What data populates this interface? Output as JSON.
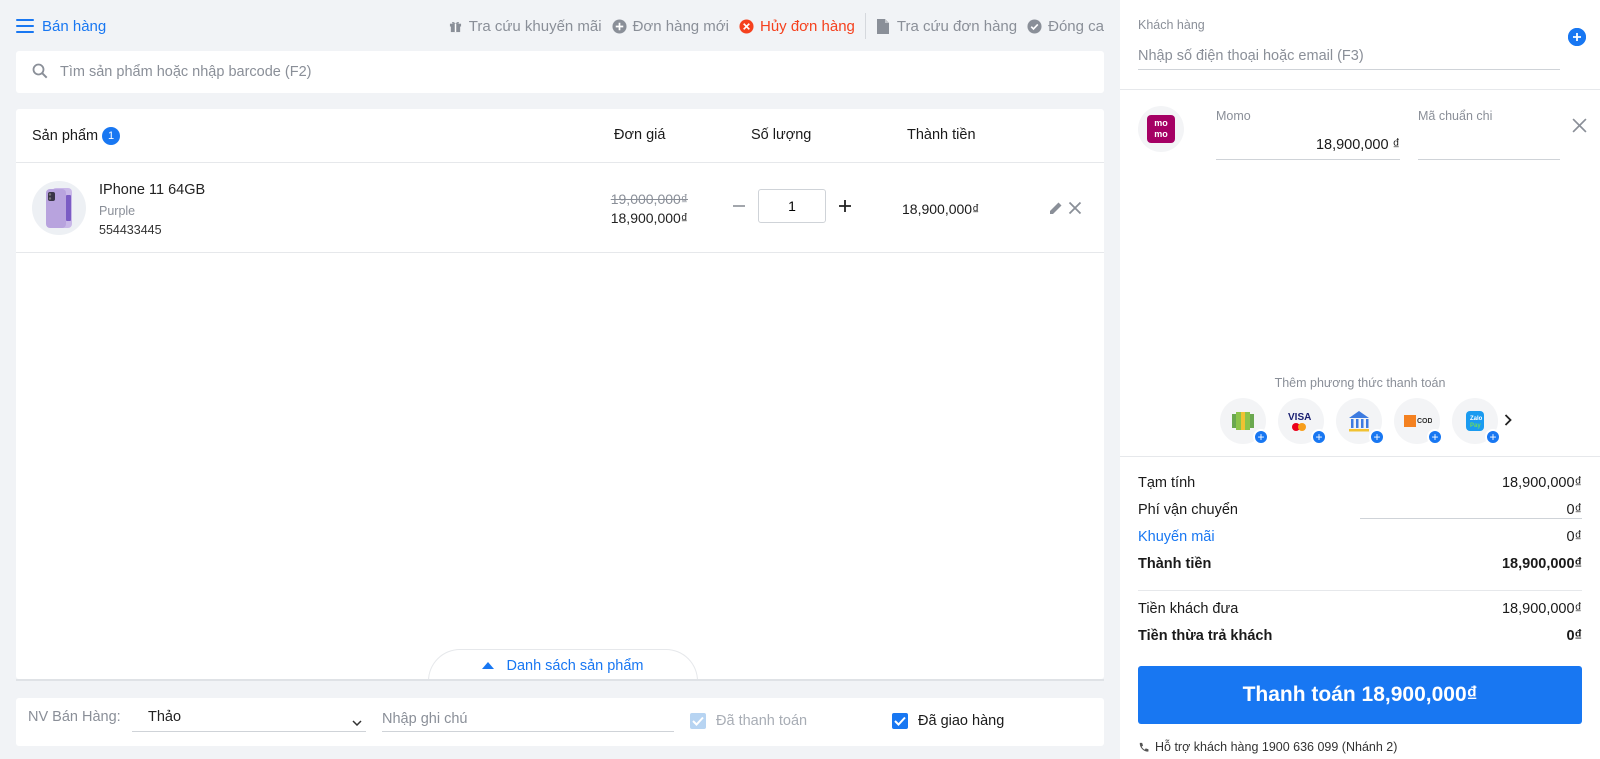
{
  "app": {
    "title": "Bán hàng"
  },
  "toolbar": {
    "promo_lookup": "Tra cứu khuyến mãi",
    "new_order": "Đơn hàng mới",
    "cancel_order": "Hủy đơn hàng",
    "order_lookup": "Tra cứu đơn hàng",
    "close_shift": "Đóng ca",
    "danger_color": "#f5411e"
  },
  "search": {
    "placeholder": "Tìm sản phẩm hoặc nhập barcode (F2)"
  },
  "table": {
    "headers": {
      "product": "Sản phẩm",
      "count": "1",
      "unit_price": "Đơn giá",
      "quantity": "Số lượng",
      "total": "Thành tiền"
    },
    "rows": [
      {
        "name": "IPhone 11 64GB",
        "variant": "Purple",
        "sku": "554433445",
        "old_price": "19,000,000₫",
        "price": "18,900,000₫",
        "quantity": "1",
        "total": "18,900,000₫"
      }
    ]
  },
  "product_list_tab": "Danh sách sản phẩm",
  "footer": {
    "staff_label": "NV Bán Hàng:",
    "staff_value": "Thảo",
    "note_placeholder": "Nhập ghi chú",
    "paid_label": "Đã thanh toán",
    "delivered_label": "Đã giao hàng"
  },
  "customer": {
    "label": "Khách hàng",
    "placeholder": "Nhập số điện thoại hoặc email (F3)"
  },
  "payment": {
    "method_name": "Momo",
    "amount": "18,900,000 ₫",
    "code_label": "Mã chuẩn chi",
    "logo_text": "mo mo",
    "add_methods_label": "Thêm phương thức thanh toán",
    "methods": [
      "cash-icon",
      "visa-card-icon",
      "bank-icon",
      "cod-icon",
      "zalopay-icon"
    ]
  },
  "summary": {
    "subtotal_label": "Tạm tính",
    "subtotal_value": "18,900,000₫",
    "shipping_label": "Phí vận chuyển",
    "shipping_value": "0₫",
    "promo_label": "Khuyến mãi",
    "promo_value": "0₫",
    "total_label": "Thành tiền",
    "total_value": "18,900,000₫",
    "paid_label": "Tiền khách đưa",
    "paid_value": "18,900,000₫",
    "change_label": "Tiền thừa trả khách",
    "change_value": "0₫"
  },
  "pay_button": "Thanh toán 18,900,000₫",
  "support": "Hỗ trợ khách hàng 1900 636 099 (Nhánh 2)",
  "colors": {
    "accent": "#1877f2",
    "momo": "#a50064"
  }
}
